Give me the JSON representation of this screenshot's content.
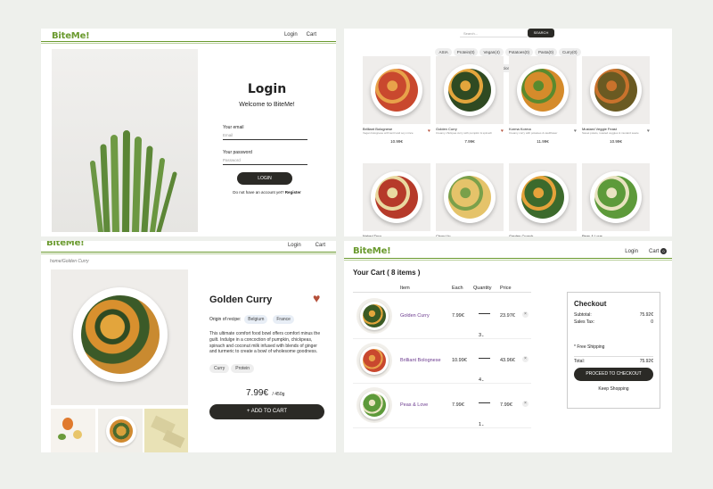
{
  "brand": "BiteMe!",
  "nav": {
    "login": "Login",
    "cart": "Cart",
    "cart_count": "0"
  },
  "login": {
    "title": "Login",
    "welcome": "Welcome to BiteMe!",
    "email_label": "Your email",
    "email_placeholder": "Email",
    "password_label": "Your password",
    "password_placeholder": "Password",
    "button": "LOGIN",
    "no_account": "Do not have an account yet?",
    "register": "Register"
  },
  "catalog": {
    "search_placeholder": "Search...",
    "search_button": "SEARCH",
    "filters": [
      "ASIA",
      "Protein(0)",
      "Vegan(4)",
      "Potatoes(0)",
      "Pasta(0)",
      "Curry(0)",
      "Rice(1)"
    ],
    "items": [
      {
        "name": "Brilliant Bolognese",
        "desc": "Vegan bolognese with lentil and soy mince",
        "price": "10.99€",
        "heart": "♥",
        "plate": "#c9482e",
        "sprinkle": "#e8a24a"
      },
      {
        "name": "Golden Curry",
        "desc": "Creamy chickpea curry with pumpkin & spinach",
        "price": "7.99€",
        "heart": "♥",
        "plate": "#2f4a22",
        "sprinkle": "#e3a53c"
      },
      {
        "name": "Korma Korma",
        "desc": "Creamy curry with potatoes & cauliflower",
        "price": "11.99€",
        "heart": "♥",
        "plate": "#d58b2b",
        "sprinkle": "#5a8a2e"
      },
      {
        "name": "Mustard Veggie Feast",
        "desc": "Sweet potato, roasted veggies & mustard sauce",
        "price": "10.99€",
        "heart": "♥",
        "plate": "#6a5a22",
        "sprinkle": "#c9722c"
      },
      {
        "name": "Naked Taco",
        "desc": "",
        "price": "",
        "heart": "♥",
        "plate": "#b63a2a",
        "sprinkle": "#e9d9a0"
      },
      {
        "name": "Chow Up",
        "desc": "",
        "price": "",
        "heart": "♥",
        "plate": "#e5c36a",
        "sprinkle": "#7aa04a"
      },
      {
        "name": "Garden Crunch",
        "desc": "",
        "price": "",
        "heart": "♥",
        "plate": "#3c6a2c",
        "sprinkle": "#e5a23a"
      },
      {
        "name": "Peas & Love",
        "desc": "",
        "price": "",
        "heart": "♥",
        "plate": "#5d9a3a",
        "sprinkle": "#e9e3c0"
      }
    ]
  },
  "product": {
    "breadcrumb": "home/Golden Curry",
    "title": "Golden Curry",
    "heart": "♥",
    "origin_label": "Origin of recipe:",
    "origins": [
      "Belgium",
      "France"
    ],
    "description": "This ultimate comfort food bowl offers comfort minus the guilt. Indulge in a concoction of pumpkin, chickpeas, spinach and coconut milk infused with blends of ginger and turmeric to create a bowl of wholesome goodness.",
    "tags": [
      "Curry",
      "Protein"
    ],
    "price": "7.99€",
    "weight": "/ 450g",
    "add_button": "+  ADD TO CART"
  },
  "cart": {
    "title": "Your Cart ( 8 items )",
    "headers": {
      "item": "Item",
      "each": "Each",
      "quantity": "Quantity",
      "price": "Price"
    },
    "rows": [
      {
        "name": "Golden Curry",
        "each": "7.99€",
        "qty": "3",
        "price": "23.97€",
        "plate": "#3a5a24",
        "sprinkle": "#e3a53c"
      },
      {
        "name": "Brilliant Bolognese",
        "each": "10.99€",
        "qty": "4",
        "price": "43.96€",
        "plate": "#c9482e",
        "sprinkle": "#e8a24a"
      },
      {
        "name": "Peas & Love",
        "each": "7.99€",
        "qty": "1",
        "price": "7.99€",
        "plate": "#5d9a3a",
        "sprinkle": "#e9e3c0"
      }
    ],
    "remove": "×",
    "checkout": {
      "title": "Checkout",
      "subtotal_label": "Subtotal:",
      "subtotal": "75.92€",
      "tax_label": "Sales Tax:",
      "tax": "0",
      "shipping": "* Free Shipping",
      "total_label": "Total:",
      "total": "75.92€",
      "button": "PROCEED TO CHECKOUT",
      "keep": "Keep Shopping"
    }
  }
}
